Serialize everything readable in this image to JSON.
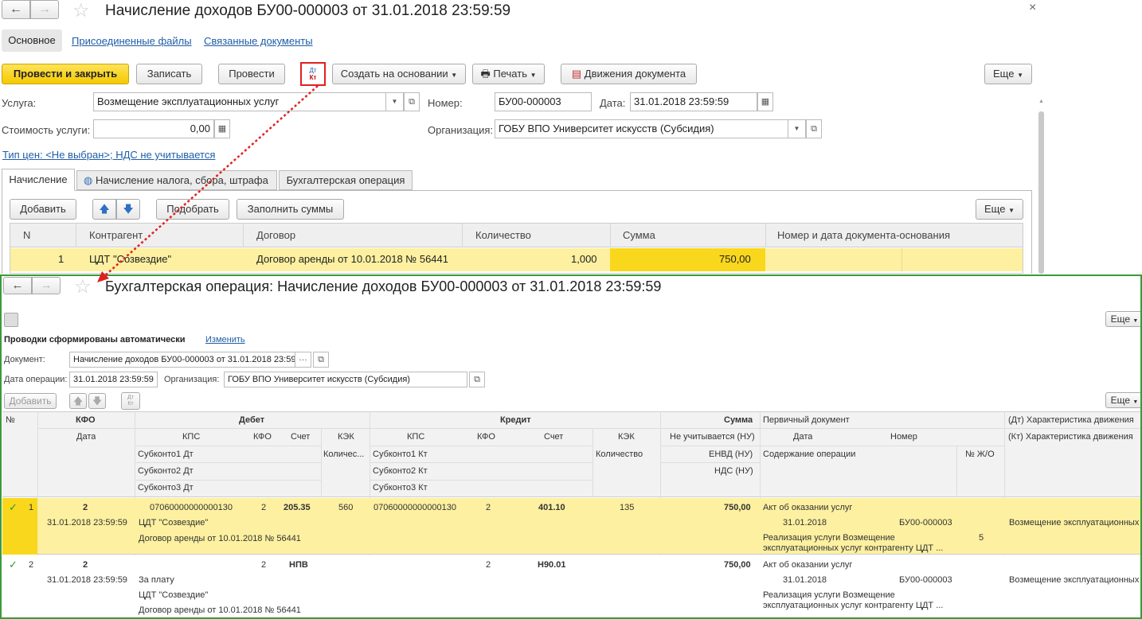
{
  "main": {
    "title": "Начисление доходов БУ00-000003 от 31.01.2018 23:59:59",
    "nav_tabs": [
      "Основное",
      "Присоединенные файлы",
      "Связанные документы"
    ],
    "toolbar": {
      "post_close": "Провести и закрыть",
      "save": "Записать",
      "post": "Провести",
      "dtkt_top": "Дт",
      "dtkt_bottom": "Кт",
      "create_based": "Создать на основании",
      "print": "Печать",
      "movements": "Движения документа",
      "more": "Еще"
    },
    "form": {
      "service_label": "Услуга:",
      "service_value": "Возмещение эксплуатационных услуг",
      "number_label": "Номер:",
      "number_value": "БУ00-000003",
      "date_label": "Дата:",
      "date_value": "31.01.2018 23:59:59",
      "cost_label": "Стоимость услуги:",
      "cost_value": "0,00",
      "org_label": "Организация:",
      "org_value": "ГОБУ ВПО Университет искусств (Субсидия)",
      "price_link": "Тип цен: <Не выбран>; НДС не учитывается"
    },
    "tabs": [
      "Начисление",
      "Начисление налога, сбора, штрафа",
      "Бухгалтерская операция"
    ],
    "table_toolbar": {
      "add": "Добавить",
      "pick": "Подобрать",
      "fill": "Заполнить суммы",
      "more": "Еще"
    },
    "table": {
      "headers": [
        "N",
        "Контрагент",
        "Договор",
        "Количество",
        "Сумма",
        "Номер и дата документа-основания"
      ],
      "rows": [
        [
          "1",
          "ЦДТ \"Созвездие\"",
          "Договор аренды от 10.01.2018 № 56441",
          "1,000",
          "750,00",
          ""
        ]
      ]
    }
  },
  "op": {
    "title": "Бухгалтерская операция: Начисление доходов БУ00-000003 от 31.01.2018 23:59:59",
    "more": "Еще",
    "auto_text": "Проводки сформированы автоматически",
    "change_link": "Изменить",
    "doc_label": "Документ:",
    "doc_value": "Начисление доходов БУ00-000003 от 31.01.2018 23:59:5",
    "date_label": "Дата операции:",
    "date_value": "31.01.2018 23:59:59",
    "org_label": "Организация:",
    "org_value": "ГОБУ ВПО Университет искусств (Субсидия)",
    "add": "Добавить",
    "dtkt_top": "Дт",
    "dtkt_bottom": "Кт",
    "more2": "Еще",
    "headers": {
      "num": "№",
      "kfo": "КФО",
      "debit": "Дебет",
      "credit": "Кредит",
      "sum": "Сумма",
      "primary": "Первичный документ",
      "char_dt": "(Дт) Характеристика движения",
      "date": "Дата",
      "kps": "КПС",
      "kfo2": "КФО",
      "account": "Счет",
      "kek": "КЭК",
      "not_counted": "Не учитывается (НУ)",
      "pdate": "Дата",
      "pnum": "Номер",
      "char_kt": "(Кт) Характеристика движения",
      "sub1_dt": "Субконто1 Дт",
      "qty_dt": "Количес...",
      "sub1_kt": "Субконто1 Кт",
      "qty_kt": "Количество",
      "envd": "ЕНВД (НУ)",
      "content": "Содержание операции",
      "journal": "№ Ж/О",
      "sub2_dt": "Субконто2 Дт",
      "sub2_kt": "Субконто2 Кт",
      "nds": "НДС (НУ)",
      "sub3_dt": "Субконто3 Дт",
      "sub3_kt": "Субконто3 Кт"
    },
    "rows": [
      {
        "num": "1",
        "kfo": "2",
        "date": "31.01.2018 23:59:59",
        "dt_kps": "07060000000000130",
        "dt_kfo": "2",
        "dt_account": "205.35",
        "dt_kek": "560",
        "kt_kps": "07060000000000130",
        "kt_kfo": "2",
        "kt_account": "401.10",
        "kt_kek": "135",
        "sum": "750,00",
        "sub1": "ЦДТ \"Созвездие\"",
        "sub2": "Договор аренды от 10.01.2018 № 56441",
        "primary": "Акт об оказании услуг",
        "pdate": "31.01.2018",
        "pnum": "БУ00-000003",
        "content1": "Реализация услуги Возмещение",
        "content2": "эксплуатационных услуг контрагенту ЦДТ ...",
        "journal": "5",
        "char": "Возмещение эксплуатационных ус"
      },
      {
        "num": "2",
        "kfo": "2",
        "date": "31.01.2018 23:59:59",
        "dt_kps": "",
        "dt_kfo": "2",
        "dt_account": "НПВ",
        "kt_kfo": "2",
        "kt_account": "Н90.01",
        "sum": "750,00",
        "sub0": "За плату",
        "sub1": "ЦДТ \"Созвездие\"",
        "sub2": "Договор аренды от 10.01.2018 № 56441",
        "primary": "Акт об оказании услуг",
        "pdate": "31.01.2018",
        "pnum": "БУ00-000003",
        "content1": "Реализация услуги Возмещение",
        "content2": "эксплуатационных услуг контрагенту ЦДТ ...",
        "char": "Возмещение эксплуатационных ус"
      }
    ]
  },
  "colors": {
    "yellow": "#fdf0a0",
    "accent_yellow": "#f9d71c",
    "green_border": "#3a9a3a",
    "red_arrow": "#e02020",
    "link": "#1f5da7"
  }
}
